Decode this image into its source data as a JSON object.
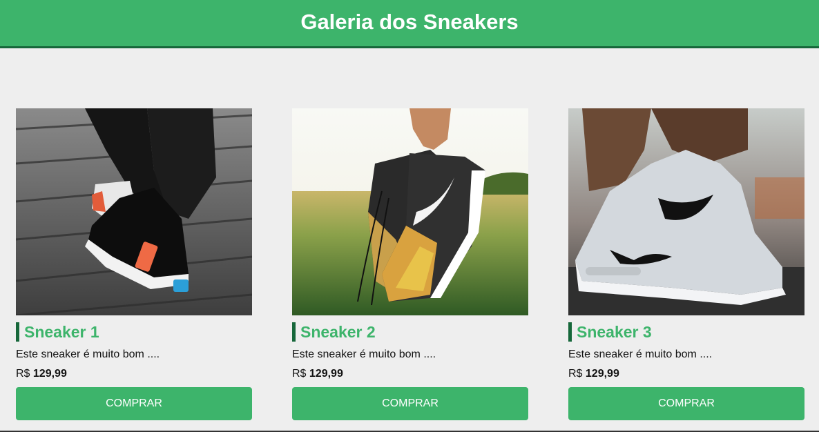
{
  "header": {
    "title": "Galeria dos Sneakers"
  },
  "colors": {
    "accent": "#3db46b",
    "accent_dark": "#16673a",
    "background": "#eeeeee"
  },
  "products": [
    {
      "name": "Sneaker 1",
      "description": "Este sneaker é muito bom ....",
      "currency": "R$",
      "price": "129,99",
      "button_label": "COMPRAR",
      "photo": "black-white-sneaker-on-wooden-deck"
    },
    {
      "name": "Sneaker 2",
      "description": "Este sneaker é muito bom ....",
      "currency": "R$",
      "price": "129,99",
      "button_label": "COMPRAR",
      "photo": "hand-holding-nike-sneakers-in-field"
    },
    {
      "name": "Sneaker 3",
      "description": "Este sneaker é muito bom ....",
      "currency": "R$",
      "price": "129,99",
      "button_label": "COMPRAR",
      "photo": "grey-nike-sneaker-on-road"
    }
  ]
}
